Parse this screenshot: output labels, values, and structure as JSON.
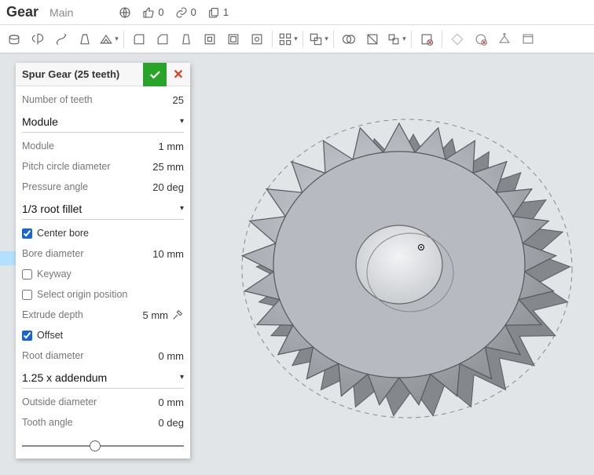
{
  "header": {
    "doc_name": "Gear",
    "tab": "Main",
    "likes": "0",
    "links": "0",
    "copies": "1"
  },
  "panel": {
    "title": "Spur Gear (25 teeth)",
    "teeth_label": "Number of teeth",
    "teeth_value": "25",
    "module_select": "Module",
    "module_label": "Module",
    "module_value": "1 mm",
    "pcd_label": "Pitch circle diameter",
    "pcd_value": "25 mm",
    "pa_label": "Pressure angle",
    "pa_value": "20 deg",
    "fillet_select": "1/3 root fillet",
    "centerbore_label": "Center bore",
    "bd_label": "Bore diameter",
    "bd_value": "10 mm",
    "keyway_label": "Keyway",
    "origin_label": "Select origin position",
    "ed_label": "Extrude depth",
    "ed_value": "5 mm",
    "offset_label": "Offset",
    "rd_label": "Root diameter",
    "rd_value": "0 mm",
    "addendum_select": "1.25 x addendum",
    "od_label": "Outside diameter",
    "od_value": "0 mm",
    "ta_label": "Tooth angle",
    "ta_value": "0 deg"
  }
}
